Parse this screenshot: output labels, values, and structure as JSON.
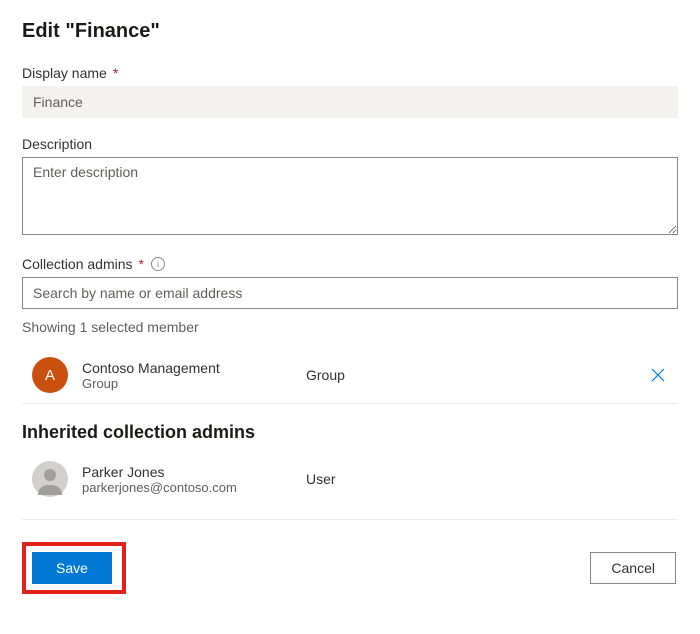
{
  "title": "Edit \"Finance\"",
  "displayName": {
    "label": "Display name",
    "value": "Finance"
  },
  "description": {
    "label": "Description",
    "placeholder": "Enter description"
  },
  "collectionAdmins": {
    "label": "Collection admins",
    "searchPlaceholder": "Search by name or email address",
    "countText": "Showing 1 selected member",
    "members": [
      {
        "initial": "A",
        "name": "Contoso Management",
        "subtext": "Group",
        "type": "Group",
        "avatarColor": "orange"
      }
    ]
  },
  "inheritedAdmins": {
    "heading": "Inherited collection admins",
    "members": [
      {
        "name": "Parker Jones",
        "subtext": "parkerjones@contoso.com",
        "type": "User"
      }
    ]
  },
  "buttons": {
    "save": "Save",
    "cancel": "Cancel"
  }
}
